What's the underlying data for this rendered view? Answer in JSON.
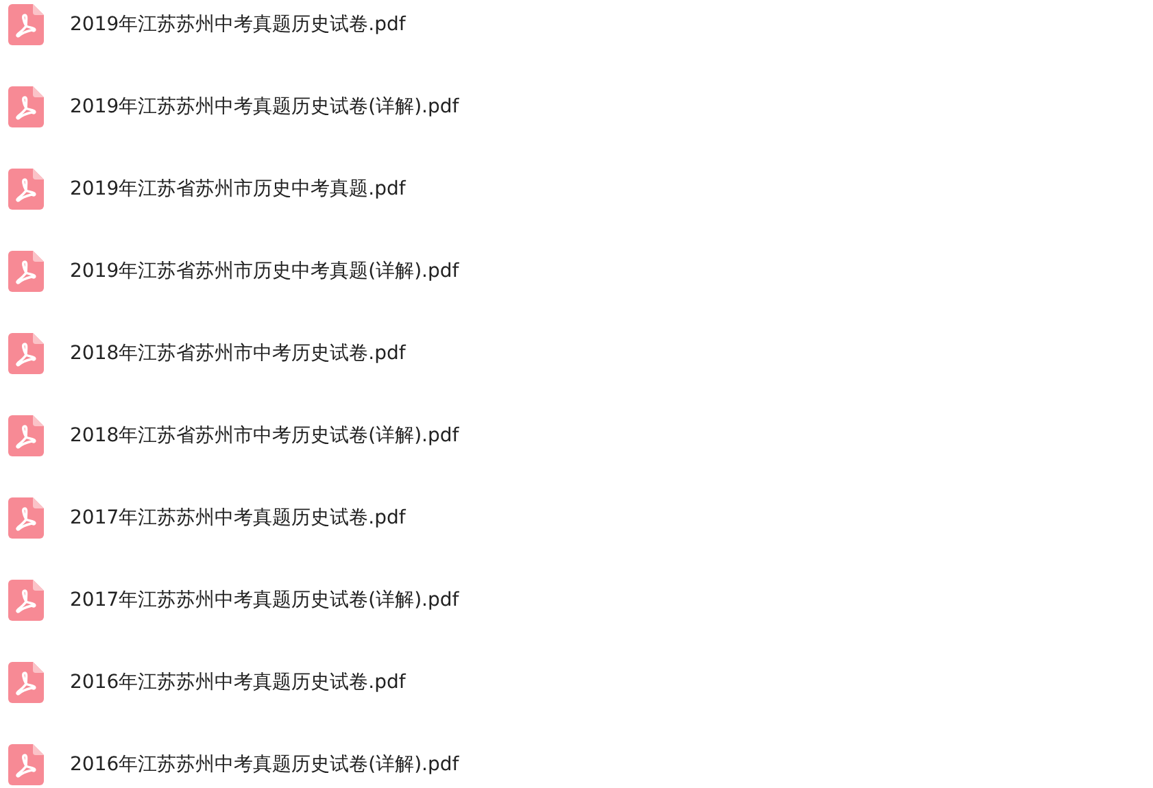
{
  "files": [
    {
      "name": "2019年江苏苏州中考真题历史试卷.pdf"
    },
    {
      "name": "2019年江苏苏州中考真题历史试卷(详解).pdf"
    },
    {
      "name": "2019年江苏省苏州市历史中考真题.pdf"
    },
    {
      "name": "2019年江苏省苏州市历史中考真题(详解).pdf"
    },
    {
      "name": "2018年江苏省苏州市中考历史试卷.pdf"
    },
    {
      "name": "2018年江苏省苏州市中考历史试卷(详解).pdf"
    },
    {
      "name": "2017年江苏苏州中考真题历史试卷.pdf"
    },
    {
      "name": "2017年江苏苏州中考真题历史试卷(详解).pdf"
    },
    {
      "name": "2016年江苏苏州中考真题历史试卷.pdf"
    },
    {
      "name": "2016年江苏苏州中考真题历史试卷(详解).pdf"
    }
  ]
}
